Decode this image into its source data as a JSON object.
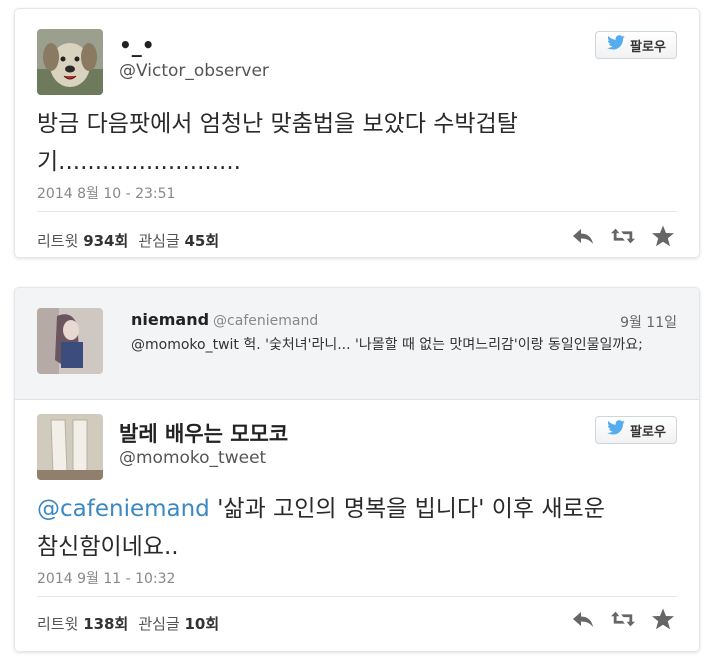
{
  "tweet1": {
    "display_name": "•_•",
    "handle": "@Victor_observer",
    "follow_label": "팔로우",
    "text_line1": "방금 다음팟에서 엄청난 맞춤법을 보았다 수박겁탈",
    "text_line2": "기.........................",
    "timestamp": "2014 8월 10 - 23:51",
    "retweet_label": "리트윗",
    "retweet_count": "934회",
    "fav_label": "관심글",
    "fav_count": "45회"
  },
  "reply_context": {
    "display_name": "niemand",
    "handle": "@cafeniemand",
    "date": "9월 11일",
    "text": "@momoko_twit 헉. '숯처녀'라니... '나몰할 때 없는 맛며느리감'이랑 동일인물일까요;"
  },
  "tweet2": {
    "display_name": "발레 배우는 모모코",
    "handle": "@momoko_tweet",
    "follow_label": "팔로우",
    "mention": "@cafeniemand",
    "text_rest": " '삶과 고인의 명복을 빕니다' 이후 새로운",
    "text_line2": "참신함이네요..",
    "timestamp": "2014 9월 11 - 10:32",
    "retweet_label": "리트윗",
    "retweet_count": "138회",
    "fav_label": "관심글",
    "fav_count": "10회"
  },
  "icons": {
    "follow": "twitter-bird-icon",
    "reply": "reply-icon",
    "retweet": "retweet-icon",
    "favorite": "star-icon"
  },
  "colors": {
    "twitter_blue": "#55acee",
    "mention": "#3b88c3"
  }
}
